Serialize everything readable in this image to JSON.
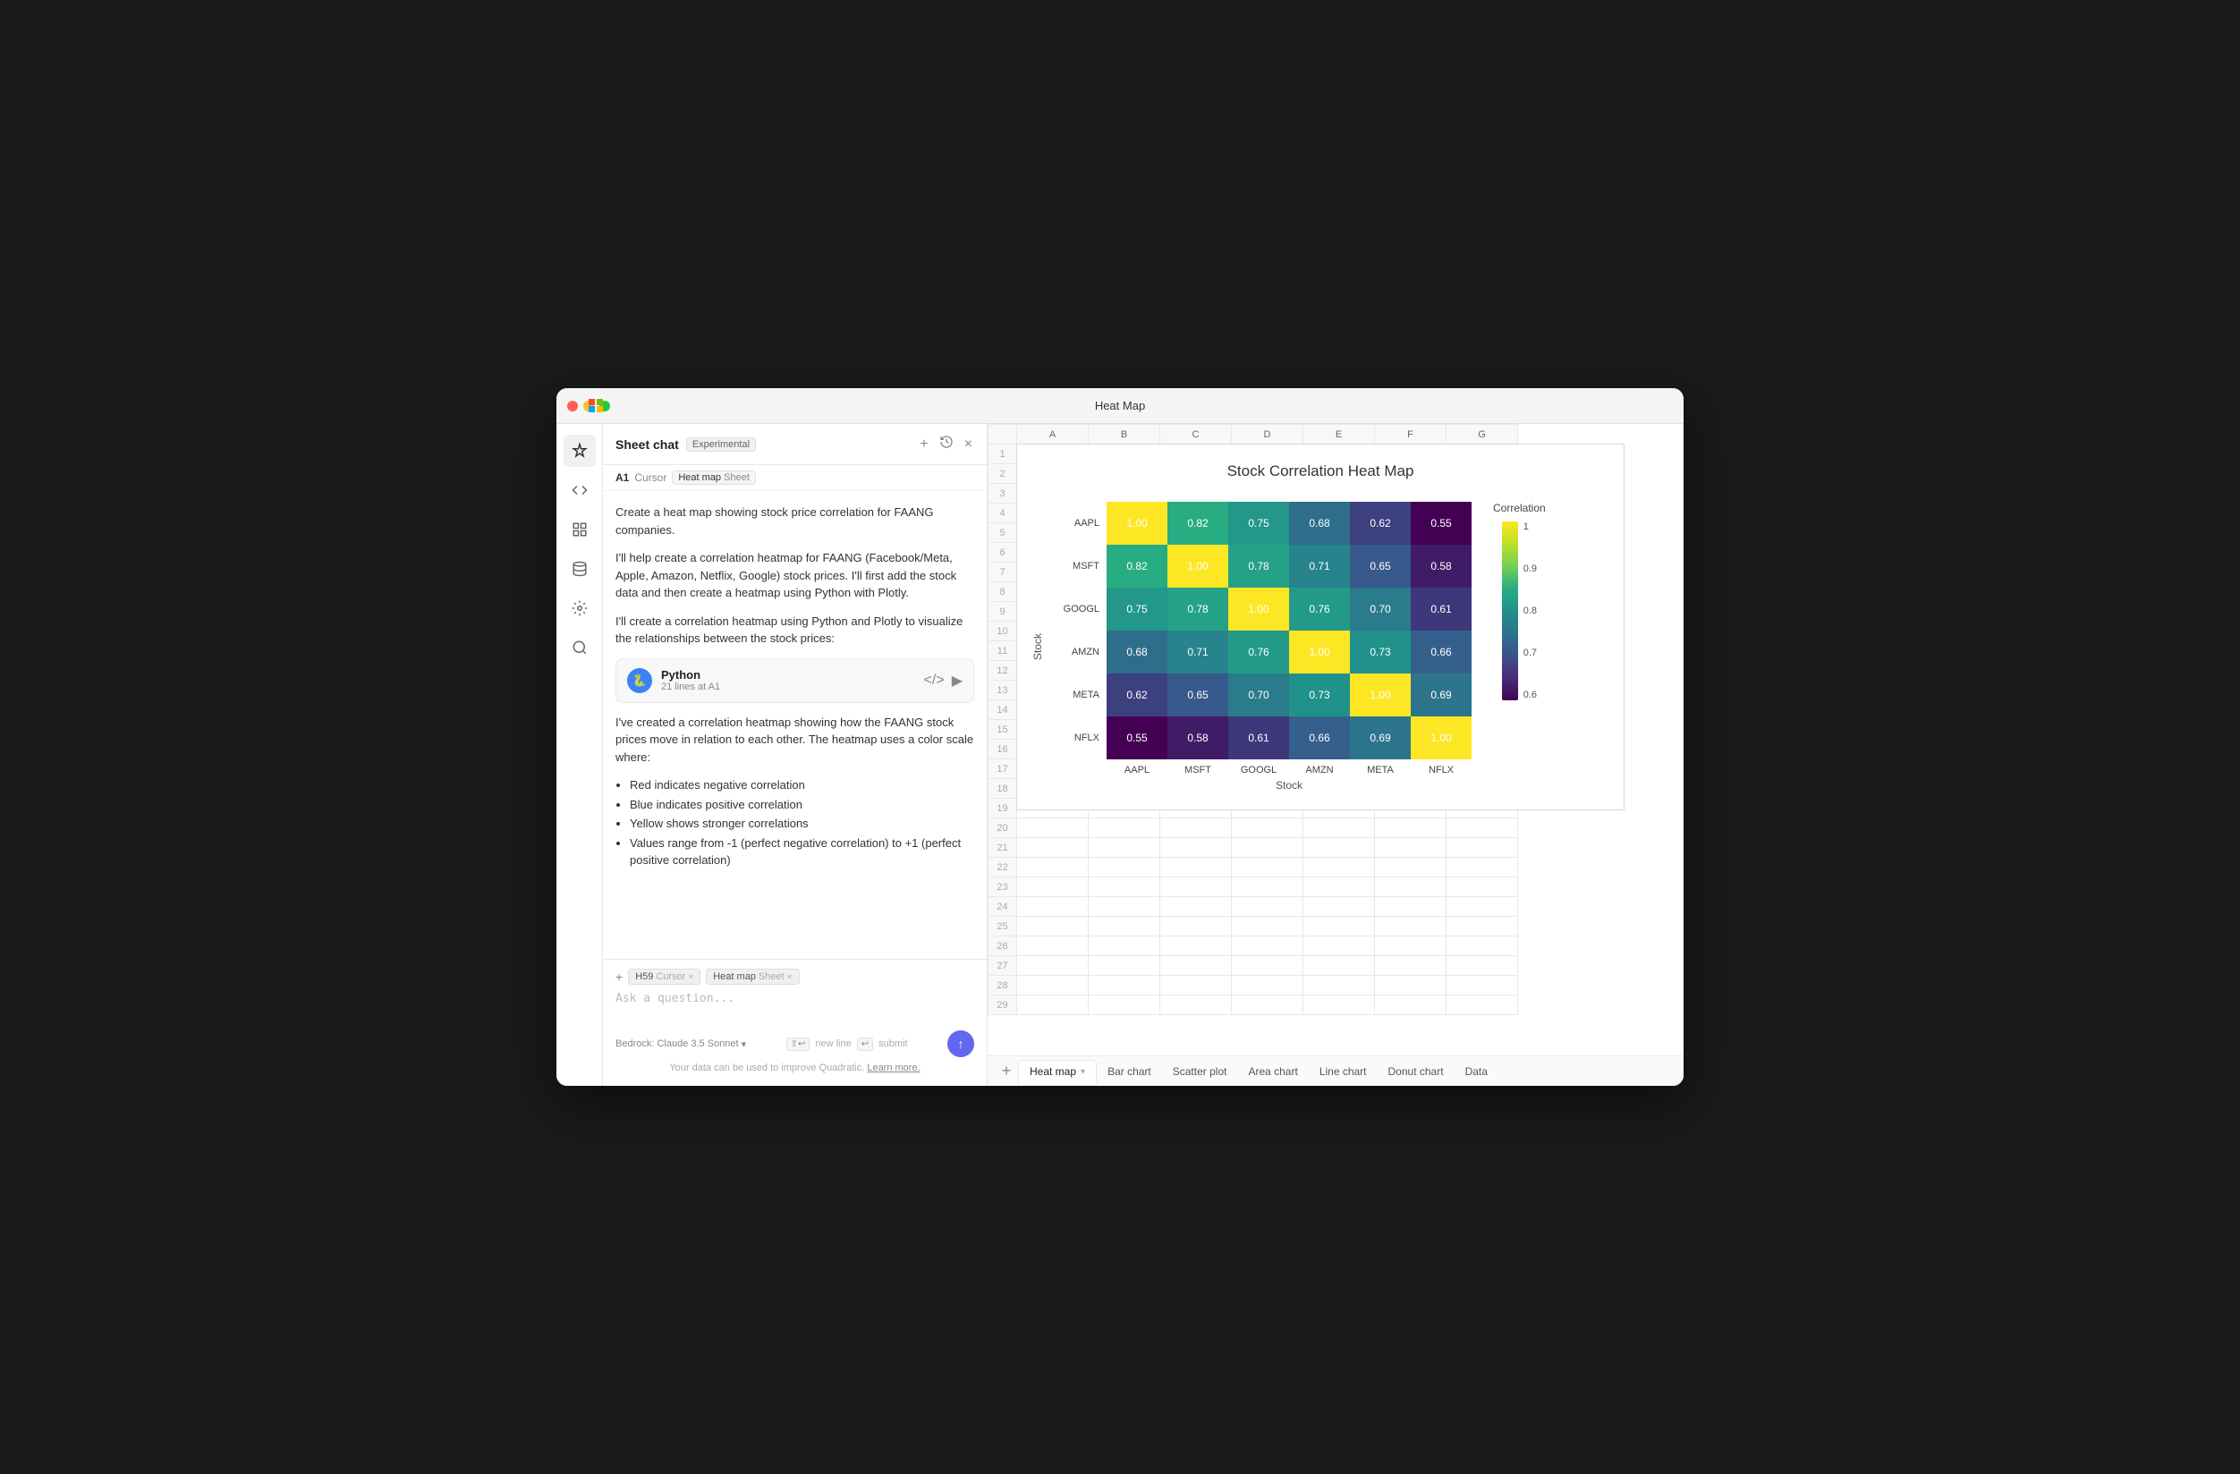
{
  "window": {
    "title": "Heat Map"
  },
  "sidebar": {
    "icons": [
      {
        "name": "sparkle-icon",
        "symbol": "✦",
        "active": true
      },
      {
        "name": "code-icon",
        "symbol": "</>",
        "active": false
      },
      {
        "name": "grid-icon",
        "symbol": "⊞",
        "active": false
      },
      {
        "name": "database-icon",
        "symbol": "🗄",
        "active": false
      },
      {
        "name": "settings-icon",
        "symbol": "⚙",
        "active": false
      },
      {
        "name": "search-icon",
        "symbol": "🔍",
        "active": false
      }
    ]
  },
  "chat": {
    "header": {
      "title": "Sheet chat",
      "badge": "Experimental",
      "plus_label": "+",
      "history_label": "↺",
      "close_label": "×"
    },
    "cell_ref": {
      "cell": "A1",
      "cursor_label": "Cursor",
      "sheet_name": "Heat map",
      "sheet_type": "Sheet"
    },
    "messages": [
      {
        "type": "user",
        "text": "Create a heat map showing stock price correlation for FAANG companies."
      },
      {
        "type": "ai",
        "text": "I'll help create a correlation heatmap for FAANG (Facebook/Meta, Apple, Amazon, Netflix, Google) stock prices. I'll first add the stock data and then create a heatmap using Python with Plotly."
      },
      {
        "type": "ai",
        "text": "I'll create a correlation heatmap using Python and Plotly to visualize the relationships between the stock prices:"
      },
      {
        "type": "code",
        "lang": "Python",
        "lines": "21 lines at A1"
      },
      {
        "type": "ai",
        "text": "I've created a correlation heatmap showing how the FAANG stock prices move in relation to each other. The heatmap uses a color scale where:"
      },
      {
        "type": "bullets",
        "items": [
          "Red indicates negative correlation",
          "Blue indicates positive correlation",
          "Yellow shows stronger correlations",
          "Values range from -1 (perfect negative correlation) to +1 (perfect positive correlation)"
        ]
      }
    ],
    "input": {
      "tags_row": {
        "plus": "+",
        "cursor_tag": "H59",
        "cursor_type": "Cursor",
        "cursor_close": "×",
        "sheet_tag": "Heat map",
        "sheet_type": "Sheet",
        "sheet_close": "×"
      },
      "placeholder": "Ask a question...",
      "model": "Bedrock: Claude 3.5 Sonnet",
      "model_arrow": "▾",
      "shortcut_newline_icon": "⇧↩",
      "shortcut_newline": "new line",
      "shortcut_submit_icon": "↩",
      "shortcut_submit": "submit"
    },
    "privacy": {
      "text": "Your data can be used to improve Quadratic.",
      "link_text": "Learn more."
    }
  },
  "spreadsheet": {
    "columns": [
      "A",
      "B",
      "C",
      "D",
      "E",
      "F",
      "G"
    ],
    "rows": 29,
    "cell_a1": "CHART"
  },
  "heatmap": {
    "title": "Stock Correlation Heat Map",
    "stocks": [
      "AAPL",
      "MSFT",
      "GOOGL",
      "AMZN",
      "META",
      "NFLX"
    ],
    "x_labels": [
      "AAPL",
      "MSFT",
      "GOOGL",
      "AMZN",
      "META",
      "NFLX"
    ],
    "x_axis_title": "Stock",
    "y_axis_title": "Stock",
    "colorbar_title": "Correlation",
    "colorbar_labels": [
      "1",
      "0.9",
      "0.8",
      "0.7",
      "0.6"
    ],
    "data": [
      [
        1.0,
        0.82,
        0.75,
        0.68,
        0.62,
        0.55
      ],
      [
        0.82,
        1.0,
        0.78,
        0.71,
        0.65,
        0.58
      ],
      [
        0.75,
        0.78,
        1.0,
        0.76,
        0.7,
        0.61
      ],
      [
        0.68,
        0.71,
        0.76,
        1.0,
        0.73,
        0.66
      ],
      [
        0.62,
        0.65,
        0.7,
        0.73,
        1.0,
        0.69
      ],
      [
        0.55,
        0.58,
        0.61,
        0.66,
        0.69,
        1.0
      ]
    ]
  },
  "tabs": {
    "add_label": "+",
    "sheets": [
      {
        "name": "Heat map",
        "active": true
      },
      {
        "name": "Bar chart",
        "active": false
      },
      {
        "name": "Scatter plot",
        "active": false
      },
      {
        "name": "Area chart",
        "active": false
      },
      {
        "name": "Line chart",
        "active": false
      },
      {
        "name": "Donut chart",
        "active": false
      },
      {
        "name": "Data",
        "active": false
      }
    ]
  }
}
